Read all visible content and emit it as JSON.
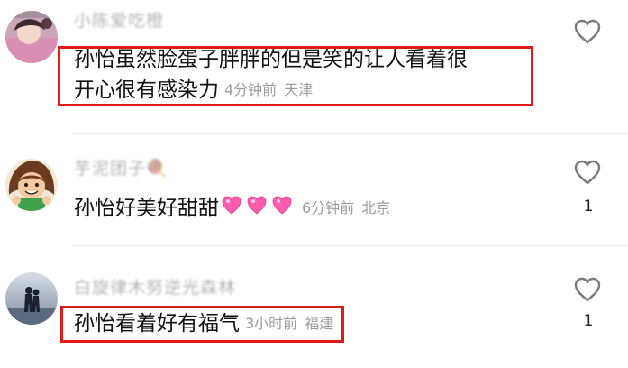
{
  "comments": [
    {
      "username": "小陈爱吃橙",
      "text_line1": "孙怡虽然脸蛋子胖胖的但是笑的让人看着很",
      "text_line2": "开心很有感染力",
      "time": "4分钟前",
      "location": "天津",
      "likes": "",
      "avatar_icon": "avatar-girl-pink"
    },
    {
      "username": "芋泥团子🍭",
      "text": "孙怡好美好甜甜",
      "emoji": "heart-emoji-x3",
      "time": "6分钟前",
      "location": "北京",
      "likes": "1",
      "avatar_icon": "avatar-cartoon-girl"
    },
    {
      "username": "白旋律木努逆光森林",
      "text": "孙怡看着好有福气",
      "time": "3小时前",
      "location": "福建",
      "likes": "1",
      "avatar_icon": "avatar-silhouette-couple"
    }
  ],
  "colors": {
    "highlight": "#e21a1a",
    "meta_text": "#9c9c9c",
    "username": "#b4b4b4",
    "emoji_heart": "#ff5cae"
  }
}
